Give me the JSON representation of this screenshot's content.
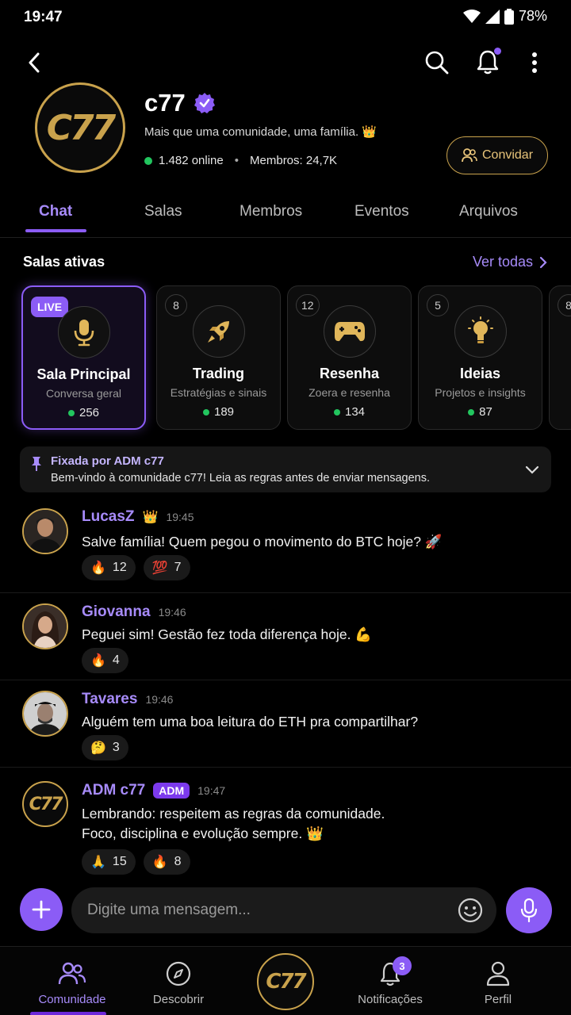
{
  "status": {
    "time": "19:47",
    "battery": "78%"
  },
  "community": {
    "logo_text": "C77",
    "name": "c77",
    "description": "Mais que uma comunidade, uma família. 👑",
    "online": "1.482 online",
    "members": "Membros: 24,7K",
    "invite_label": "Convidar"
  },
  "tabs": [
    "Chat",
    "Salas",
    "Membros",
    "Eventos",
    "Arquivos"
  ],
  "rooms_section": {
    "title": "Salas ativas",
    "see_all": "Ver todas"
  },
  "rooms": [
    {
      "badge": "LIVE",
      "icon": "microphone-icon",
      "name": "Sala Principal",
      "subtitle": "Conversa geral",
      "online": "256"
    },
    {
      "badge": "8",
      "icon": "rocket-icon",
      "name": "Trading",
      "subtitle": "Estratégias e sinais",
      "online": "189"
    },
    {
      "badge": "12",
      "icon": "gamepad-icon",
      "name": "Resenha",
      "subtitle": "Zoera e resenha",
      "online": "134"
    },
    {
      "badge": "5",
      "icon": "lightbulb-icon",
      "name": "Ideias",
      "subtitle": "Projetos e insights",
      "online": "87"
    },
    {
      "badge": "8"
    }
  ],
  "pinned": {
    "title": "Fixada por ADM c77",
    "text": "Bem-vindo à comunidade c77! Leia as regras antes de enviar mensagens."
  },
  "messages": [
    {
      "user": "LucasZ",
      "crown": "👑",
      "time": "19:45",
      "text": "Salve família! Quem pegou o movimento do BTC hoje? 🚀",
      "reactions": [
        {
          "emoji": "🔥",
          "count": "12"
        },
        {
          "emoji": "💯",
          "count": "7"
        }
      ]
    },
    {
      "user": "Giovanna",
      "time": "19:46",
      "text": "Peguei sim! Gestão fez toda diferença hoje. 💪",
      "reactions": [
        {
          "emoji": "🔥",
          "count": "4"
        }
      ]
    },
    {
      "user": "Tavares",
      "time": "19:46",
      "text": "Alguém tem uma boa leitura do ETH pra compartilhar?",
      "reactions": [
        {
          "emoji": "🤔",
          "count": "3"
        }
      ]
    },
    {
      "user": "ADM c77",
      "badge": "ADM",
      "time": "19:47",
      "line1": "Lembrando: respeitem as regras da comunidade.",
      "line2": "Foco, disciplina e evolução sempre. 👑",
      "reactions": [
        {
          "emoji": "🙏",
          "count": "15"
        },
        {
          "emoji": "🔥",
          "count": "8"
        }
      ]
    }
  ],
  "composer": {
    "placeholder": "Digite uma mensagem..."
  },
  "nav": {
    "items": [
      "Comunidade",
      "Descobrir",
      "Notificações",
      "Perfil"
    ],
    "center_logo": "C77",
    "notif_badge": "3"
  },
  "colors": {
    "accent": "#8b5cf6",
    "gold": "#c9a24c",
    "online": "#22c55e",
    "background": "#000000"
  }
}
